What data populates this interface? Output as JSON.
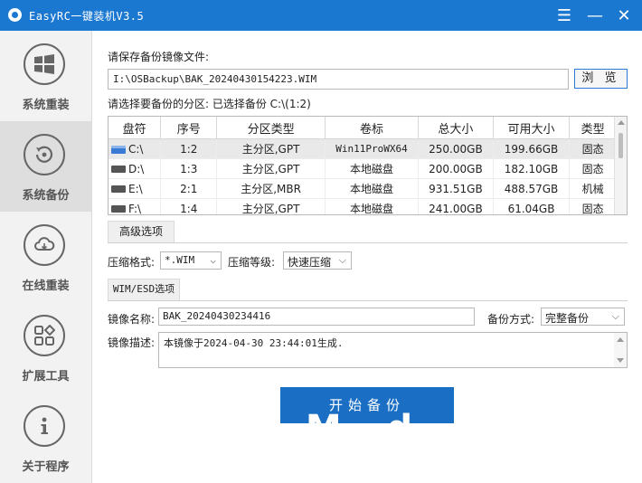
{
  "window": {
    "title": "EasyRC一键装机V3.5"
  },
  "sidebar": {
    "items": [
      {
        "label": "系统重装",
        "icon": "windows-icon"
      },
      {
        "label": "系统备份",
        "icon": "backup-icon"
      },
      {
        "label": "在线重装",
        "icon": "cloud-icon"
      },
      {
        "label": "扩展工具",
        "icon": "apps-icon"
      },
      {
        "label": "关于程序",
        "icon": "info-icon"
      }
    ],
    "active": 1
  },
  "backup": {
    "save_label": "请保存备份镜像文件:",
    "path": "I:\\OSBackup\\BAK_20240430154223.WIM",
    "browse": "浏 览",
    "select_label": "请选择要备份的分区: 已选择备份 C:\\(1:2)"
  },
  "table": {
    "headers": [
      "盘符",
      "序号",
      "分区类型",
      "卷标",
      "总大小",
      "可用大小",
      "类型"
    ],
    "rows": [
      [
        "C:\\",
        "1:2",
        "主分区,GPT",
        "Win11ProWX64",
        "250.00GB",
        "199.66GB",
        "固态"
      ],
      [
        "D:\\",
        "1:3",
        "主分区,GPT",
        "本地磁盘",
        "200.00GB",
        "182.10GB",
        "固态"
      ],
      [
        "E:\\",
        "2:1",
        "主分区,MBR",
        "本地磁盘",
        "931.51GB",
        "488.57GB",
        "机械"
      ],
      [
        "F:\\",
        "1:4",
        "主分区,GPT",
        "本地磁盘",
        "241.00GB",
        "61.04GB",
        "固态"
      ]
    ]
  },
  "advanced": {
    "tab": "高级选项",
    "compress_format_label": "压缩格式:",
    "compress_format": "*.WIM",
    "compress_level_label": "压缩等级:",
    "compress_level": "快速压缩"
  },
  "wim": {
    "tab": "WIM/ESD选项",
    "name_label": "镜像名称:",
    "name": "BAK_20240430234416",
    "mode_label": "备份方式:",
    "mode": "完整备份",
    "desc_label": "镜像描述:",
    "desc": "本镜像于2024-04-30 23:44:01生成."
  },
  "start": {
    "label": "开始备份"
  }
}
